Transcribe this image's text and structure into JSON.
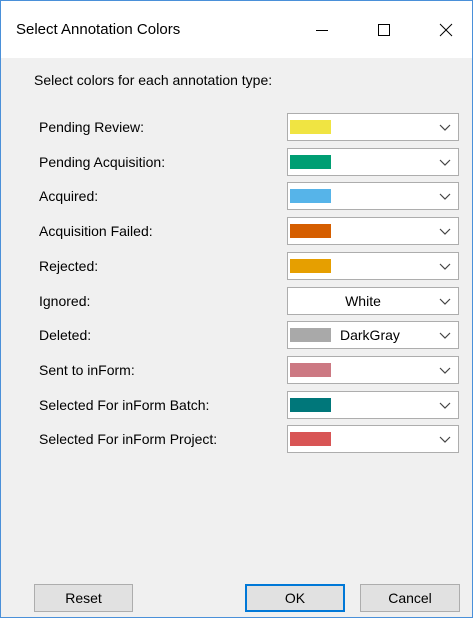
{
  "window": {
    "title": "Select Annotation Colors"
  },
  "instruction": "Select colors for each annotation type:",
  "rows": [
    {
      "label": "Pending Review:",
      "swatch": "#f0e442",
      "value": ""
    },
    {
      "label": "Pending Acquisition:",
      "swatch": "#009e73",
      "value": ""
    },
    {
      "label": "Acquired:",
      "swatch": "#56b4e9",
      "value": ""
    },
    {
      "label": "Acquisition Failed:",
      "swatch": "#d55e00",
      "value": ""
    },
    {
      "label": "Rejected:",
      "swatch": "#e69f00",
      "value": ""
    },
    {
      "label": "Ignored:",
      "swatch": "",
      "value": "White"
    },
    {
      "label": "Deleted:",
      "swatch": "#a9a9a9",
      "value": "DarkGray"
    },
    {
      "label": "Sent to inForm:",
      "swatch": "#cc7983",
      "value": ""
    },
    {
      "label": "Selected For inForm Batch:",
      "swatch": "#00777a",
      "value": ""
    },
    {
      "label": "Selected For inForm Project:",
      "swatch": "#d85555",
      "value": ""
    }
  ],
  "buttons": {
    "reset": "Reset",
    "ok": "OK",
    "cancel": "Cancel"
  }
}
